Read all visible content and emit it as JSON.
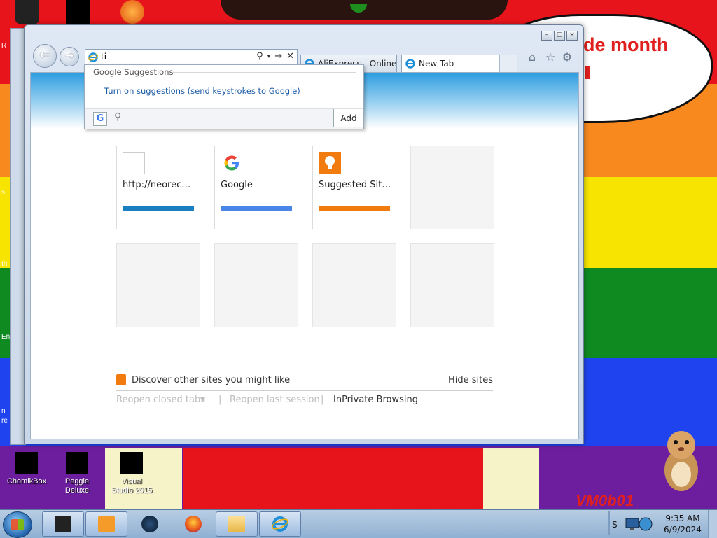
{
  "desktop": {
    "bubble_text": "de month",
    "watermark": "VM0b01",
    "edge_texts": [
      "R",
      "s",
      "th",
      "En",
      "n",
      "re"
    ],
    "icons": [
      {
        "label": "ChomikBox"
      },
      {
        "label": "Peggle Deluxe"
      },
      {
        "label": "Visual Studio 2015"
      }
    ]
  },
  "browser": {
    "address": {
      "value": "ti"
    },
    "tabs": [
      {
        "label": "AliExpress - Online ..."
      },
      {
        "label": "New Tab"
      }
    ],
    "suggestions": {
      "header": "Google Suggestions",
      "turn_on": "Turn on suggestions (send keystrokes to Google)",
      "add": "Add"
    },
    "tiles": [
      {
        "label": "http://neorecon...",
        "bar_color": "#1a7fc1"
      },
      {
        "label": "Google",
        "bar_color": "#4a86e8"
      },
      {
        "label": "Suggested Sites",
        "bar_color": "#f27b10"
      }
    ],
    "discover": "Discover other sites you might like",
    "hide_sites": "Hide sites",
    "links": {
      "reopen_tabs": "Reopen closed tabs",
      "reopen_session": "Reopen last session",
      "inprivate": "InPrivate Browsing"
    }
  },
  "taskbar": {
    "tray_label": "S",
    "time": "9:35 AM",
    "date": "6/9/2024"
  }
}
